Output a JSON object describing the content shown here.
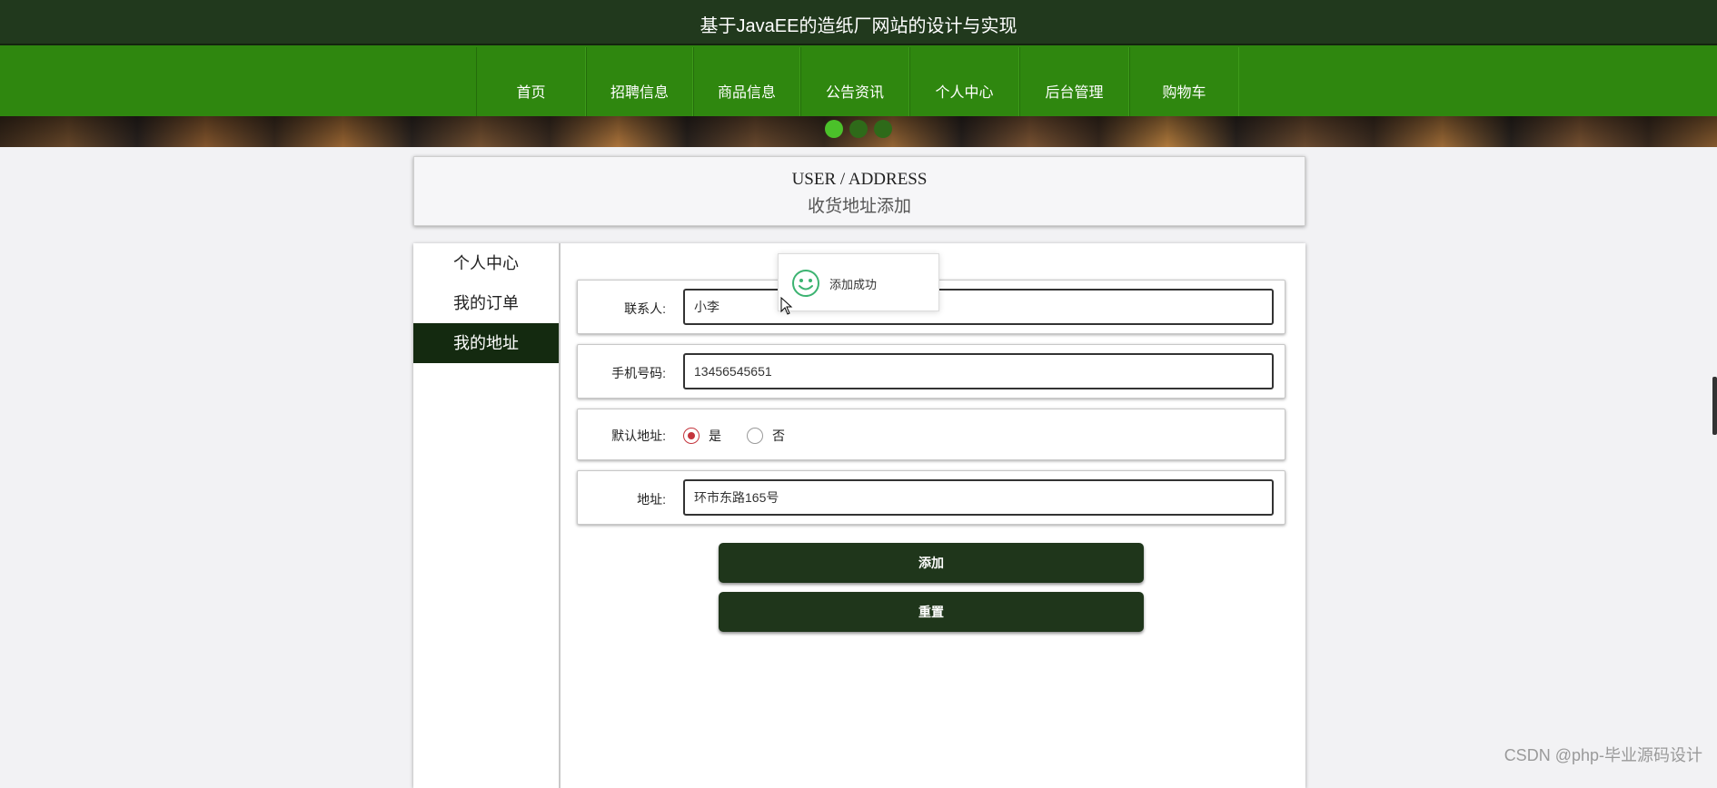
{
  "header": {
    "title": "基于JavaEE的造纸厂网站的设计与实现"
  },
  "nav": {
    "items": [
      "首页",
      "招聘信息",
      "商品信息",
      "公告资讯",
      "个人中心",
      "后台管理",
      "购物车"
    ]
  },
  "banner": {
    "active_dot": 1,
    "dot_count": 3
  },
  "heading": {
    "en": "USER / ADDRESS",
    "cn": "收货地址添加"
  },
  "sidebar": {
    "items": [
      "个人中心",
      "我的订单",
      "我的地址"
    ],
    "active": "我的地址"
  },
  "form": {
    "contact_label": "联系人:",
    "contact_value": "小李",
    "phone_label": "手机号码:",
    "phone_value": "13456545651",
    "default_label": "默认地址:",
    "default_yes": "是",
    "default_no": "否",
    "default_selected": "是",
    "address_label": "地址:",
    "address_value": "环市东路165号",
    "add_button": "添加",
    "reset_button": "重置"
  },
  "toast": {
    "message": "添加成功",
    "icon": "smiley-icon",
    "icon_color": "#3cb371"
  },
  "colors": {
    "topbar": "#21391d",
    "navbar": "#2f870f",
    "button": "#1f361b",
    "sidebar_active": "#142a10"
  },
  "watermark": "CSDN @php-毕业源码设计"
}
